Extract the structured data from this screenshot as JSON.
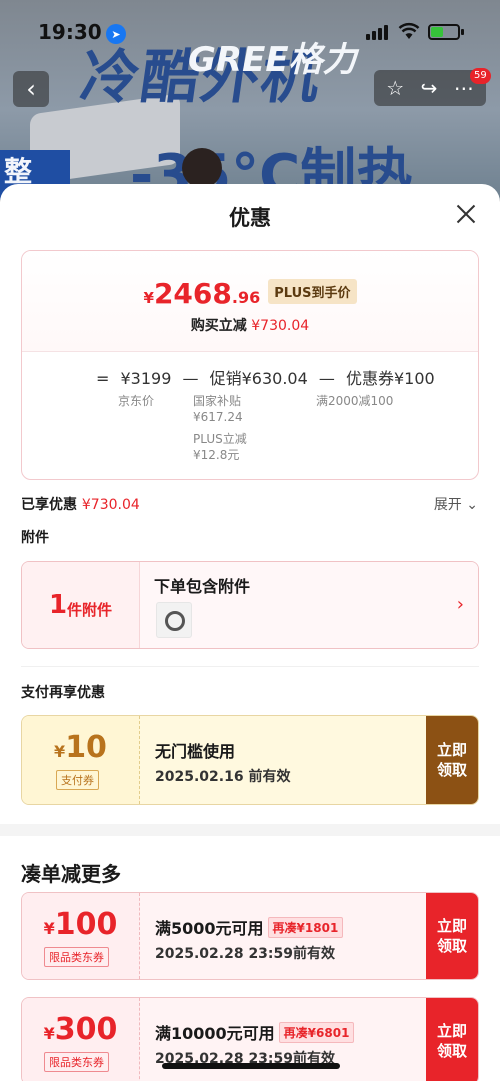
{
  "status": {
    "time": "19:30",
    "notif_badge": "59"
  },
  "banner": {
    "title1": "冷酷外机",
    "title2": "-35°C制热",
    "brand": "GREE格力",
    "left_text": "整"
  },
  "sheet": {
    "title": "优惠",
    "price": {
      "yen": "¥",
      "int": "2468",
      "dec": ".96",
      "tag": "PLUS到手价",
      "saving_label": "购买立减",
      "saving_value": "¥730.04"
    },
    "formula": {
      "eq": "=",
      "jd": "¥3199",
      "minus1": "—",
      "promo": "促销¥630.04",
      "minus2": "—",
      "coupon": "优惠券¥100",
      "jd_label": "京东价",
      "promo_sub1": "国家补贴",
      "promo_sub1_val": "¥617.24",
      "promo_sub2": "PLUS立减",
      "promo_sub2_val": "¥12.8元",
      "coupon_sub": "满2000减100"
    },
    "enjoyed": {
      "label": "已享优惠",
      "value": "¥730.04",
      "expand": "展开 ⌄"
    },
    "accessory": {
      "section": "附件",
      "count": "1",
      "unit": "件附件",
      "title": "下单包含附件"
    },
    "pay": {
      "section": "支付再享优惠",
      "yen": "¥",
      "amount": "10",
      "tag": "支付券",
      "t1": "无门槛使用",
      "t2": "2025.02.16 前有效",
      "btn": "立即领取"
    },
    "more": {
      "title": "凑单减更多",
      "coupons": [
        {
          "yen": "¥",
          "amount": "100",
          "tag": "限品类东券",
          "t1": "满5000元可用",
          "extra": "再凑¥1801",
          "t2": "2025.02.28 23:59前有效",
          "btn": "立即领取"
        },
        {
          "yen": "¥",
          "amount": "300",
          "tag": "限品类东券",
          "t1": "满10000元可用",
          "extra": "再凑¥6801",
          "t2": "2025.02.28 23:59前有效",
          "btn": "立即领取"
        }
      ]
    }
  },
  "colors": {
    "accent_red": "#e8242a",
    "pay_brown": "#8c5114",
    "plus_gold": "#f6e4c6"
  }
}
